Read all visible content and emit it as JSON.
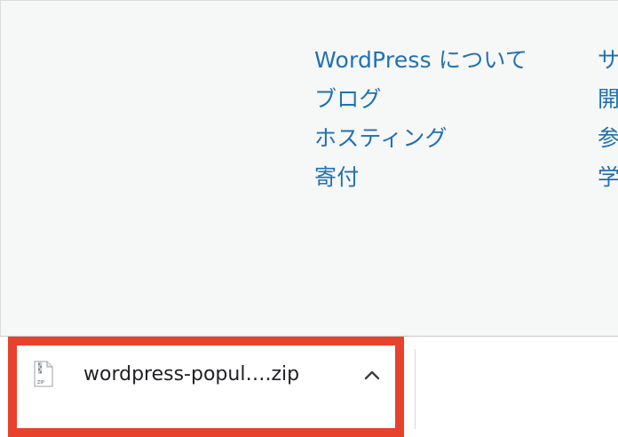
{
  "footer": {
    "column1": [
      {
        "label": "WordPress について"
      },
      {
        "label": "ブログ"
      },
      {
        "label": "ホスティング"
      },
      {
        "label": "寄付"
      }
    ],
    "column2": [
      {
        "label": "サ"
      },
      {
        "label": "開"
      },
      {
        "label": "参"
      },
      {
        "label": "学"
      }
    ]
  },
  "download_shelf": {
    "file_name": "wordpress-popul….zip",
    "file_icon": "zip-file-icon",
    "file_icon_text": "ZIP",
    "menu_icon": "chevron-up-icon"
  },
  "colors": {
    "link": "#2271b1",
    "highlight": "#e8412c",
    "background": "#f6f7f7"
  }
}
